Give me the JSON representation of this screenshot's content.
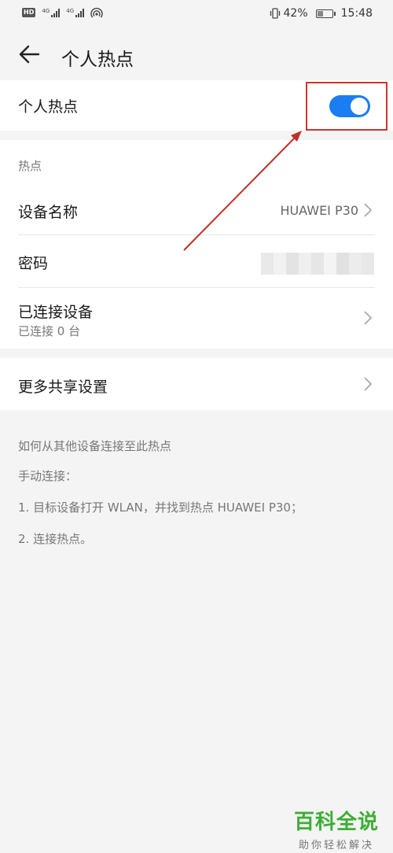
{
  "status_bar": {
    "net_badge": "HD",
    "sim1_label": "4G",
    "sim2_label": "4G",
    "battery_pct": "42%",
    "battery_level": 0.42,
    "time": "15:48"
  },
  "header": {
    "title": "个人热点"
  },
  "hotspot_toggle": {
    "label": "个人热点",
    "enabled": true,
    "accent_color": "#1a7df3"
  },
  "hotspot_section": {
    "heading": "热点",
    "device_name_label": "设备名称",
    "device_name_value": "HUAWEI P30",
    "password_label": "密码",
    "connected_label": "已连接设备",
    "connected_sub": "已连接 0 台"
  },
  "more_sharing": {
    "label": "更多共享设置"
  },
  "help": {
    "title": "如何从其他设备连接至此热点",
    "line1": "手动连接：",
    "line2": "1. 目标设备打开 WLAN，并找到热点 HUAWEI P30；",
    "line3": "2. 连接热点。"
  },
  "watermark": {
    "main": "百科全说",
    "sub": "助你轻松解决"
  },
  "icons": {
    "back": "back-arrow-icon",
    "chevron": "chevron-right-icon"
  }
}
